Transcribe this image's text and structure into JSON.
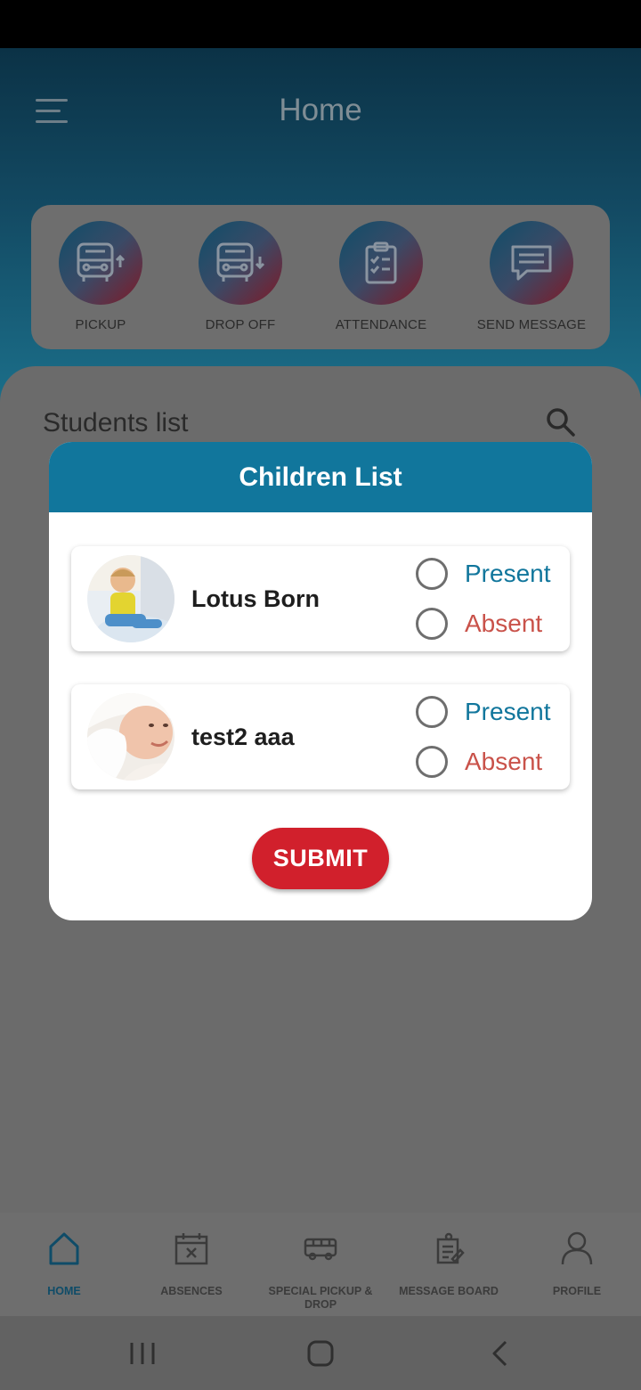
{
  "header": {
    "title": "Home"
  },
  "quick_actions": [
    {
      "label": "PICKUP",
      "icon": "bus-pickup-icon"
    },
    {
      "label": "DROP OFF",
      "icon": "bus-dropoff-icon"
    },
    {
      "label": "ATTENDANCE",
      "icon": "clipboard-check-icon"
    },
    {
      "label": "SEND MESSAGE",
      "icon": "chat-message-icon"
    }
  ],
  "students": {
    "title": "Students list"
  },
  "modal": {
    "title": "Children List",
    "children": [
      {
        "name": "Lotus Born",
        "present_label": "Present",
        "absent_label": "Absent"
      },
      {
        "name": "test2 aaa",
        "present_label": "Present",
        "absent_label": "Absent"
      }
    ],
    "submit_label": "SUBMIT"
  },
  "bottom_nav": [
    {
      "label": "HOME",
      "icon": "home-icon",
      "active": true
    },
    {
      "label": "ABSENCES",
      "icon": "calendar-x-icon"
    },
    {
      "label": "SPECIAL PICKUP & DROP",
      "icon": "bus-icon"
    },
    {
      "label": "MESSAGE BOARD",
      "icon": "message-board-icon"
    },
    {
      "label": "PROFILE",
      "icon": "profile-icon"
    }
  ],
  "colors": {
    "primary": "#11769c",
    "submit": "#d1202c",
    "absent": "#c9524a"
  }
}
